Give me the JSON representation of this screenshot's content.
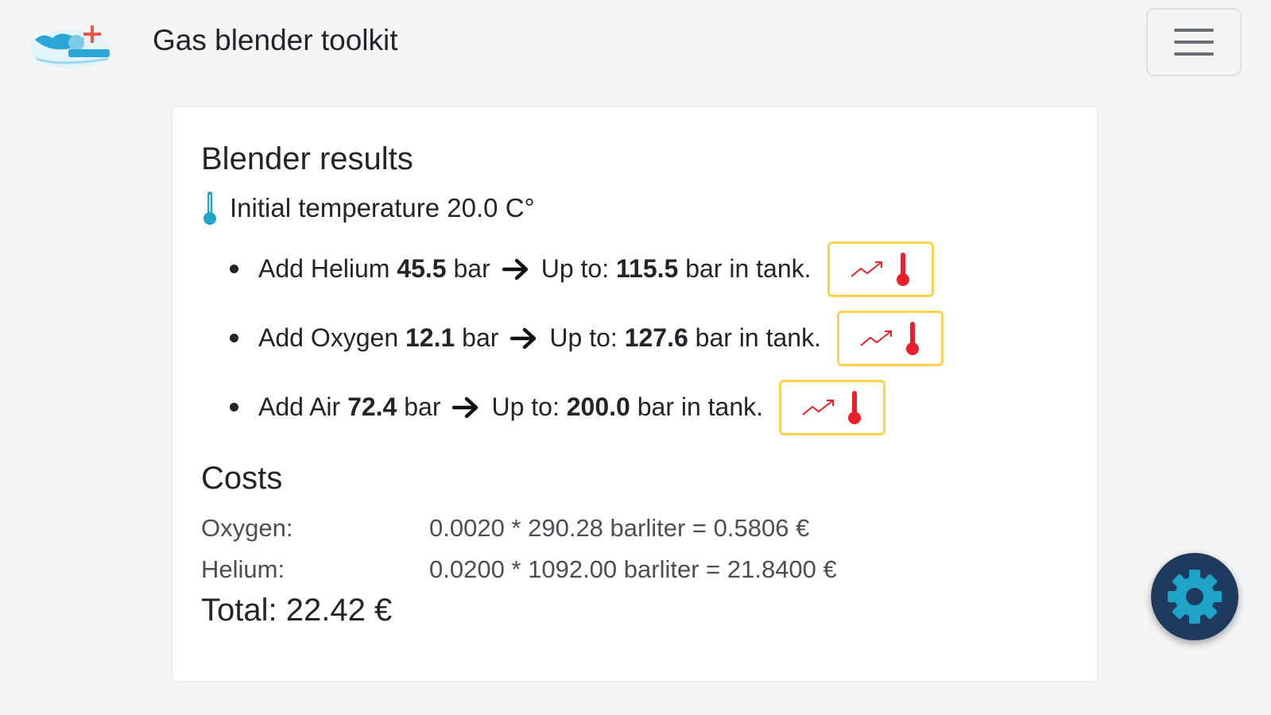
{
  "header": {
    "title": "Gas blender toolkit",
    "logo_icon": "diver-logo-icon",
    "menu_icon": "hamburger-icon"
  },
  "results": {
    "heading": "Blender results",
    "initial_temperature_label": "Initial temperature 20.0 C°",
    "steps": [
      {
        "prefix": "Add Helium",
        "amount": "45.5",
        "unit1": "bar",
        "upto_label": "Up to:",
        "upto": "115.5",
        "suffix": "bar in tank."
      },
      {
        "prefix": "Add Oxygen",
        "amount": "12.1",
        "unit1": "bar",
        "upto_label": "Up to:",
        "upto": "127.6",
        "suffix": "bar in tank."
      },
      {
        "prefix": "Add Air",
        "amount": "72.4",
        "unit1": "bar",
        "upto_label": "Up to:",
        "upto": "200.0",
        "suffix": "bar in tank."
      }
    ]
  },
  "costs": {
    "heading": "Costs",
    "rows": [
      {
        "label": "Oxygen:",
        "value": "0.0020 * 290.28 barliter = 0.5806 €"
      },
      {
        "label": "Helium:",
        "value": "0.0200 * 1092.00 barliter = 21.8400 €"
      }
    ],
    "total": "Total: 22.42 €"
  },
  "colors": {
    "accent": "#1fa3c9",
    "warning_border": "#fcd34d",
    "thermo_red": "#e8202a",
    "fab": "#1f3a5f"
  }
}
